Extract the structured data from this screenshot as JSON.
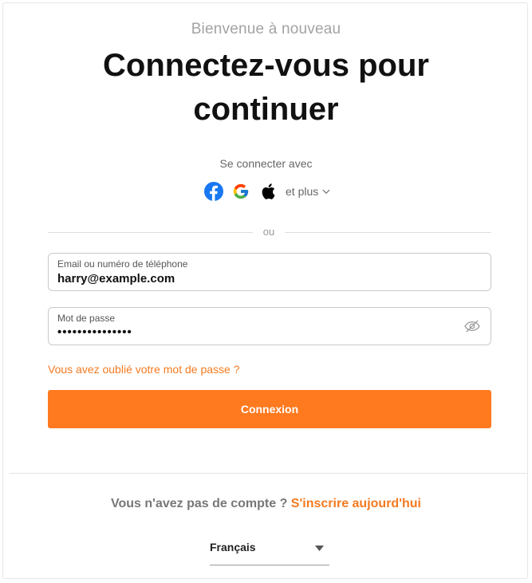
{
  "header": {
    "welcome": "Bienvenue à nouveau",
    "title_line1": "Connectez-vous pour",
    "title_line2": "continuer"
  },
  "social": {
    "connect_with": "Se connecter avec",
    "providers": [
      {
        "name": "Facebook",
        "icon": "facebook-icon",
        "color": "#1877f2"
      },
      {
        "name": "Google",
        "icon": "google-icon"
      },
      {
        "name": "Apple",
        "icon": "apple-icon",
        "color": "#000000"
      }
    ],
    "more_label": "et plus"
  },
  "divider": {
    "label": "ou"
  },
  "form": {
    "email": {
      "label": "Email ou numéro de téléphone",
      "value": "harry@example.com"
    },
    "password": {
      "label": "Mot de passe",
      "value": "•••••••••••••••"
    },
    "forgot_label": "Vous avez oublié votre mot de passe ?",
    "submit_label": "Connexion"
  },
  "footer": {
    "no_account": "Vous n'avez pas de compte ?",
    "signup_link": "S'inscrire aujourd'hui",
    "language": "Français"
  },
  "colors": {
    "accent": "#ff7a1f",
    "link": "#f47a20"
  }
}
